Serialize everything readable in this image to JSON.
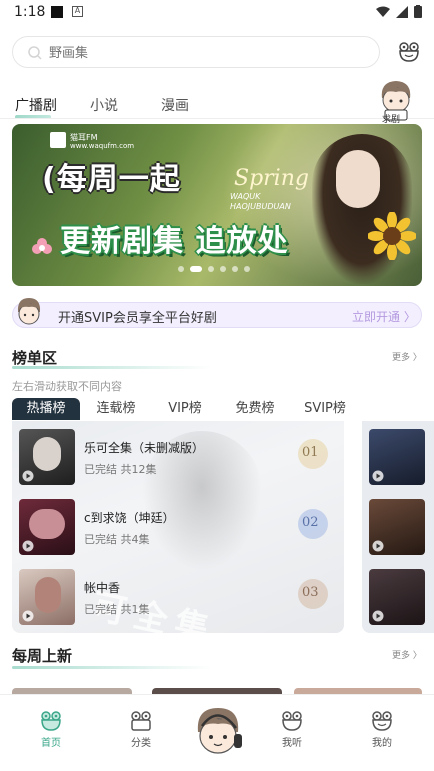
{
  "status": {
    "time": "1:18"
  },
  "search": {
    "placeholder": "野画集"
  },
  "tabs": [
    {
      "label": "广播剧"
    },
    {
      "label": "小说"
    },
    {
      "label": "漫画"
    }
  ],
  "qiuju": {
    "label": "求剧"
  },
  "banner": {
    "brand": "猫耳FM",
    "url": "www.waqufm.com",
    "title_line1": "(每周一起",
    "title_line2": "更新剧集 追放处",
    "spring": "Spring",
    "spring_sub": "WAQUK HAOJUBUDUAN",
    "active_slide": 1,
    "slide_count": 6
  },
  "svip": {
    "text": "开通SVIP会员享全平台好剧",
    "action": "立即开通 〉"
  },
  "ranking": {
    "title": "榜单区",
    "more": "更多 〉",
    "hint": "左右滑动获取不同内容",
    "tabs": [
      {
        "label": "热播榜"
      },
      {
        "label": "连载榜"
      },
      {
        "label": "VIP榜"
      },
      {
        "label": "免费榜"
      },
      {
        "label": "SVIP榜"
      }
    ],
    "watermark": "可全集",
    "items": [
      {
        "title": "乐可全集（未删减版）",
        "meta": "已完结 共12集",
        "rank": "01"
      },
      {
        "title": "c到求饶（坤廷）",
        "meta": "已完结 共4集",
        "rank": "02"
      },
      {
        "title": "帐中香",
        "meta": "已完结 共1集",
        "rank": "03"
      }
    ]
  },
  "weekly": {
    "title": "每周上新",
    "more": "更多 〉"
  },
  "nav": [
    {
      "label": "首页"
    },
    {
      "label": "分类"
    },
    {
      "label": "我听"
    },
    {
      "label": "我的"
    }
  ],
  "colors": {
    "accent": "#3aa689",
    "svip": "#b59ae0",
    "tab_dark": "#23323f"
  }
}
